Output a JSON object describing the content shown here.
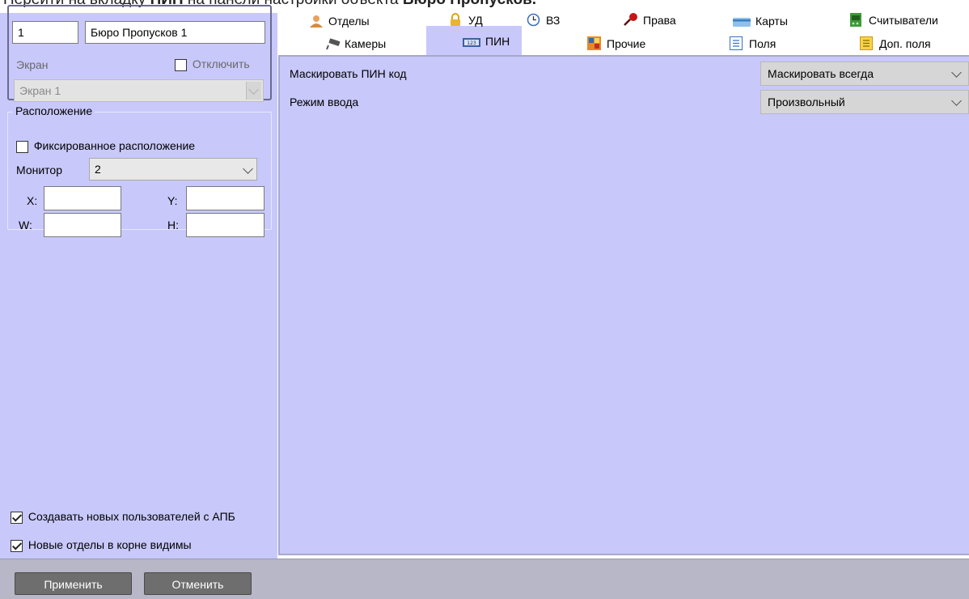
{
  "doc": {
    "prefix": "Перейти на вкладку ",
    "tab_bold": "ПИН",
    "middle": " на панели настройки объекта ",
    "object_bold": "Бюро Пропусков."
  },
  "left": {
    "id_value": "1",
    "name_value": "Бюро Пропусков 1",
    "screen_label": "Экран",
    "disable_label": "Отключить",
    "screen_combo_value": "Экран 1",
    "location_group_title": "Расположение",
    "fixed_location_label": "Фиксированное расположение",
    "monitor_label": "Монитор",
    "monitor_value": "2",
    "x_label": "X:",
    "y_label": "Y:",
    "w_label": "W:",
    "h_label": "H:",
    "x_value": "",
    "y_value": "",
    "w_value": "",
    "h_value": "",
    "create_users_label": "Создавать новых пользователей с АПБ",
    "create_users_checked": true,
    "new_departments_label": "Новые отделы в корне видимы",
    "new_departments_checked": true
  },
  "tabs": {
    "row1": [
      "Отделы",
      "УД",
      "ВЗ",
      "Права",
      "Карты",
      "Считыватели"
    ],
    "row2": [
      "Камеры",
      "ПИН",
      "Прочие",
      "Поля",
      "Доп. поля"
    ],
    "active": "ПИН",
    "icons": [
      "user-icon",
      "lock-icon",
      "clock-icon",
      "key-icon",
      "card-icon",
      "reader-icon",
      "camera-icon",
      "pin-icon",
      "misc-icon",
      "fields-icon",
      "extra-fields-icon"
    ]
  },
  "pin_settings": {
    "mask_label": "Маскировать ПИН код",
    "mask_value": "Маскировать всегда",
    "input_mode_label": "Режим ввода",
    "input_mode_value": "Произвольный"
  },
  "buttons": {
    "apply": "Применить",
    "cancel": "Отменить"
  },
  "colors": {
    "panel_bg": "#c8c8fb",
    "bottom_bar": "#b7b7c8",
    "button_bg": "#6e6e6e"
  }
}
